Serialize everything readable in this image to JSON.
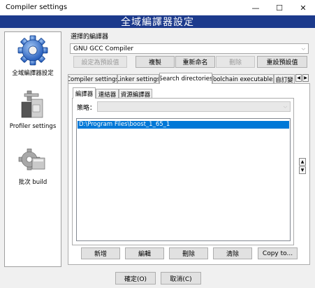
{
  "window": {
    "title": "Compiler settings",
    "controls": {
      "minimize": "—",
      "maximize": "☐",
      "close": "✕"
    }
  },
  "banner": {
    "title": "全域編譯器設定"
  },
  "sidebar": {
    "items": [
      {
        "label": "全域編譯器設定",
        "icon": "gear-icon",
        "selected": true
      },
      {
        "label": "Profiler settings",
        "icon": "profiler-icon",
        "selected": false
      },
      {
        "label": "批次 build",
        "icon": "batch-build-icon",
        "selected": false
      }
    ]
  },
  "compiler_select": {
    "label": "選擇的編譯器",
    "value": "GNU GCC Compiler"
  },
  "compiler_buttons": {
    "set_default": "設定為預設值",
    "copy": "複製",
    "rename": "重新命名",
    "delete": "刪除",
    "reset_defaults": "重設預設值"
  },
  "tabs": {
    "items": [
      "Compiler settings",
      "Linker settings",
      "Search directories",
      "Toolchain executables",
      "自訂變"
    ],
    "active": "Search directories"
  },
  "subtabs": {
    "items": [
      "編譯器",
      "連結器",
      "資源編譯器"
    ],
    "active": "編譯器"
  },
  "policy": {
    "label": "策略：",
    "value": ""
  },
  "directories": [
    "D:\\Program Files\\boost_1_65_1"
  ],
  "list_buttons": {
    "add": "新增",
    "edit": "編輯",
    "delete": "刪除",
    "clear": "清除",
    "copy_to": "Copy to..."
  },
  "dialog_buttons": {
    "ok": "確定(O)",
    "cancel": "取消(C)"
  }
}
